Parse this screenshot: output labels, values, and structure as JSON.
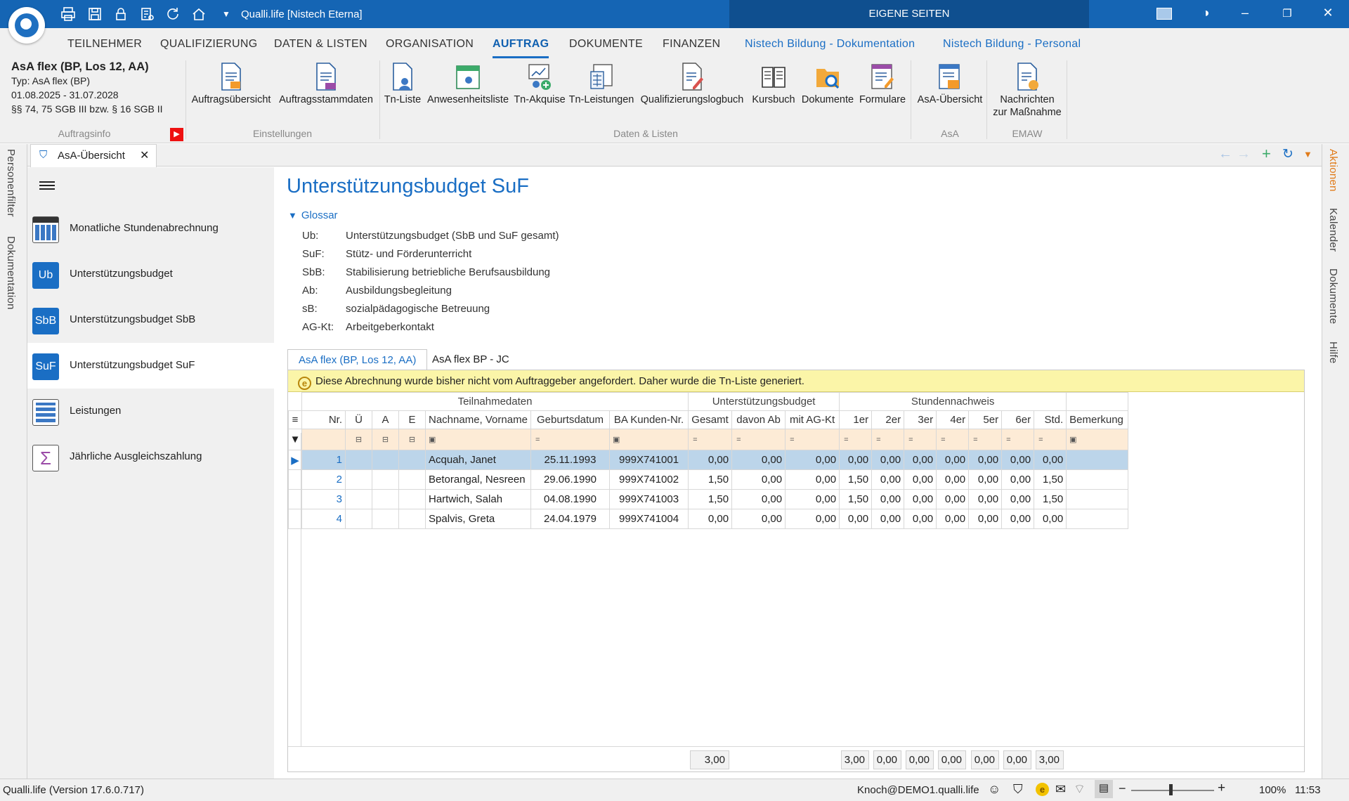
{
  "window": {
    "title": "Qualli.life [Nistech Eterna]",
    "center_title": "EIGENE SEITEN"
  },
  "menu": [
    "TEILNEHMER",
    "QUALIFIZIERUNG",
    "DATEN & LISTEN",
    "ORGANISATION",
    "AUFTRAG",
    "DOKUMENTE",
    "FINANZEN",
    "Nistech Bildung - Dokumentation",
    "Nistech Bildung - Personal"
  ],
  "menu_active": "AUFTRAG",
  "ribbon": {
    "info": {
      "title": "AsA flex (BP, Los 12, AA)",
      "typ": "Typ: AsA flex (BP)",
      "dates": "01.08.2025 - 31.07.2028",
      "law": "§§ 74, 75 SGB III bzw. § 16 SGB II",
      "group": "Auftragsinfo"
    },
    "einstellungen": {
      "group": "Einstellungen",
      "b1": "Auftragsübersicht",
      "b2": "Auftragsstammdaten"
    },
    "daten": {
      "group": "Daten & Listen",
      "b1": "Tn-Liste",
      "b2": "Anwesenheitsliste",
      "b3": "Tn-Akquise",
      "b4": "Tn-Leistungen",
      "b5": "Qualifizierungslogbuch",
      "b6": "Kursbuch",
      "b7": "Dokumente",
      "b8": "Formulare"
    },
    "asa": {
      "group": "AsA",
      "b1": "AsA-Übersicht"
    },
    "emaw": {
      "group": "EMAW",
      "b1a": "Nachrichten",
      "b1b": "zur Maßnahme"
    }
  },
  "left_strip": {
    "a": "Personenfilter",
    "b": "Dokumentation"
  },
  "right_strip": {
    "a": "Aktionen",
    "b": "Kalender",
    "c": "Dokumente",
    "d": "Hilfe"
  },
  "doc_tab": "AsA-Übersicht",
  "nav": {
    "i1": "Monatliche Stundenabrechnung",
    "i2": "Unterstützungsbudget",
    "i2_badge": "Ub",
    "i3": "Unterstützungsbudget SbB",
    "i3_badge": "SbB",
    "i4": "Unterstützungsbudget SuF",
    "i4_badge": "SuF",
    "i5": "Leistungen",
    "i6": "Jährliche Ausgleichszahlung"
  },
  "page": {
    "title": "Unterstützungsbudget SuF",
    "glossar": "Glossar",
    "gloss": [
      {
        "k": "Ub:",
        "v": "Unterstützungsbudget (SbB und SuF gesamt)"
      },
      {
        "k": "SuF:",
        "v": "Stütz- und Förderunterricht"
      },
      {
        "k": "SbB:",
        "v": "Stabilisierung betriebliche Berufsausbildung"
      },
      {
        "k": "Ab:",
        "v": "Ausbildungsbegleitung"
      },
      {
        "k": "sB:",
        "v": "sozialpädagogische Betreuung"
      },
      {
        "k": "AG-Kt:",
        "v": "Arbeitgeberkontakt"
      }
    ],
    "tab1": "AsA flex (BP, Los 12, AA)",
    "tab2": "AsA flex BP - JC",
    "warning": "Diese Abrechnung wurde bisher nicht vom Auftraggeber angefordert. Daher wurde die Tn-Liste generiert."
  },
  "grid": {
    "groups": {
      "g1": "Teilnahmedaten",
      "g2": "Unterstützungsbudget",
      "g3": "Stundennachweis"
    },
    "cols": {
      "nr": "Nr.",
      "u": "Ü",
      "a": "A",
      "e": "E",
      "name": "Nachname, Vorname",
      "geb": "Geburtsdatum",
      "ba": "BA Kunden-Nr.",
      "ges": "Gesamt",
      "ab": "davon Ab",
      "ag": "mit AG-Kt",
      "h1": "1er",
      "h2": "2er",
      "h3": "3er",
      "h4": "4er",
      "h5": "5er",
      "h6": "6er",
      "std": "Std.",
      "bem": "Bemerkung"
    },
    "rows": [
      {
        "nr": "1",
        "name": "Acquah, Janet",
        "geb": "25.11.1993",
        "ba": "999X741001",
        "ges": "0,00",
        "ab": "0,00",
        "ag": "0,00",
        "h1": "0,00",
        "h2": "0,00",
        "h3": "0,00",
        "h4": "0,00",
        "h5": "0,00",
        "h6": "0,00",
        "std": "0,00"
      },
      {
        "nr": "2",
        "name": "Betorangal, Nesreen",
        "geb": "29.06.1990",
        "ba": "999X741002",
        "ges": "1,50",
        "ab": "0,00",
        "ag": "0,00",
        "h1": "1,50",
        "h2": "0,00",
        "h3": "0,00",
        "h4": "0,00",
        "h5": "0,00",
        "h6": "0,00",
        "std": "1,50"
      },
      {
        "nr": "3",
        "name": "Hartwich, Salah",
        "geb": "04.08.1990",
        "ba": "999X741003",
        "ges": "1,50",
        "ab": "0,00",
        "ag": "0,00",
        "h1": "1,50",
        "h2": "0,00",
        "h3": "0,00",
        "h4": "0,00",
        "h5": "0,00",
        "h6": "0,00",
        "std": "1,50"
      },
      {
        "nr": "4",
        "name": "Spalvis, Greta",
        "geb": "24.04.1979",
        "ba": "999X741004",
        "ges": "0,00",
        "ab": "0,00",
        "ag": "0,00",
        "h1": "0,00",
        "h2": "0,00",
        "h3": "0,00",
        "h4": "0,00",
        "h5": "0,00",
        "h6": "0,00",
        "std": "0,00"
      }
    ],
    "sums": {
      "ges": "3,00",
      "h1": "3,00",
      "h2": "0,00",
      "h3": "0,00",
      "h4": "0,00",
      "h5": "0,00",
      "h6": "0,00",
      "std": "3,00"
    }
  },
  "status": {
    "version": "Qualli.life (Version 17.6.0.717)",
    "user": "Knoch@DEMO1.qualli.life",
    "zoom": "100%",
    "time": "11:53"
  },
  "colors": {
    "accent": "#1a6ec4",
    "titlebar": "#1565b4",
    "warning_bg": "#fbf5a8",
    "selected_row": "#bcd5ea",
    "filter_row": "#fdebd6"
  }
}
